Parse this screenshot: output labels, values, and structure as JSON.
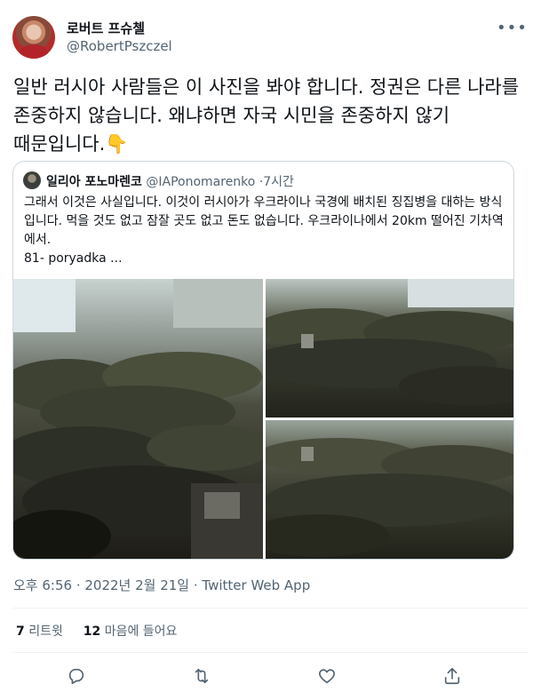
{
  "author": {
    "display_name": "로버트 프슈첼",
    "handle": "@RobertPszczel"
  },
  "tweet": {
    "text": "일반 러시아 사람들은 이 사진을 봐야 합니다. 정권은 다른 나라를 존중하지 않습니다. 왜냐하면 자국 시민을 존중하지 않기 때문입니다.👇"
  },
  "quoted": {
    "display_name": "일리아 포노마렌코",
    "handle": "@IAPonomarenko",
    "age": "·7시간",
    "text": "그래서 이것은 사실입니다. 이것이 러시아가 우크라이나 국경에 배치된 징집병을 대하는 방식입니다. 먹을 것도 없고 잠잘 곳도 없고 돈도 없습니다. 우크라이나에서 20km 떨어진 기차역에서.",
    "text_extra": " 81- poryadka ..."
  },
  "meta": {
    "timestamp": "오후 6:56 · 2022년 2월 21일 · Twitter Web App"
  },
  "stats": {
    "retweets_count": "7",
    "retweets_label": "리트윗",
    "likes_count": "12",
    "likes_label": "마음에 들어요"
  },
  "icons": {
    "more": "more-dots-icon",
    "reply": "reply-icon",
    "retweet": "retweet-icon",
    "like": "heart-icon",
    "share": "share-icon"
  }
}
